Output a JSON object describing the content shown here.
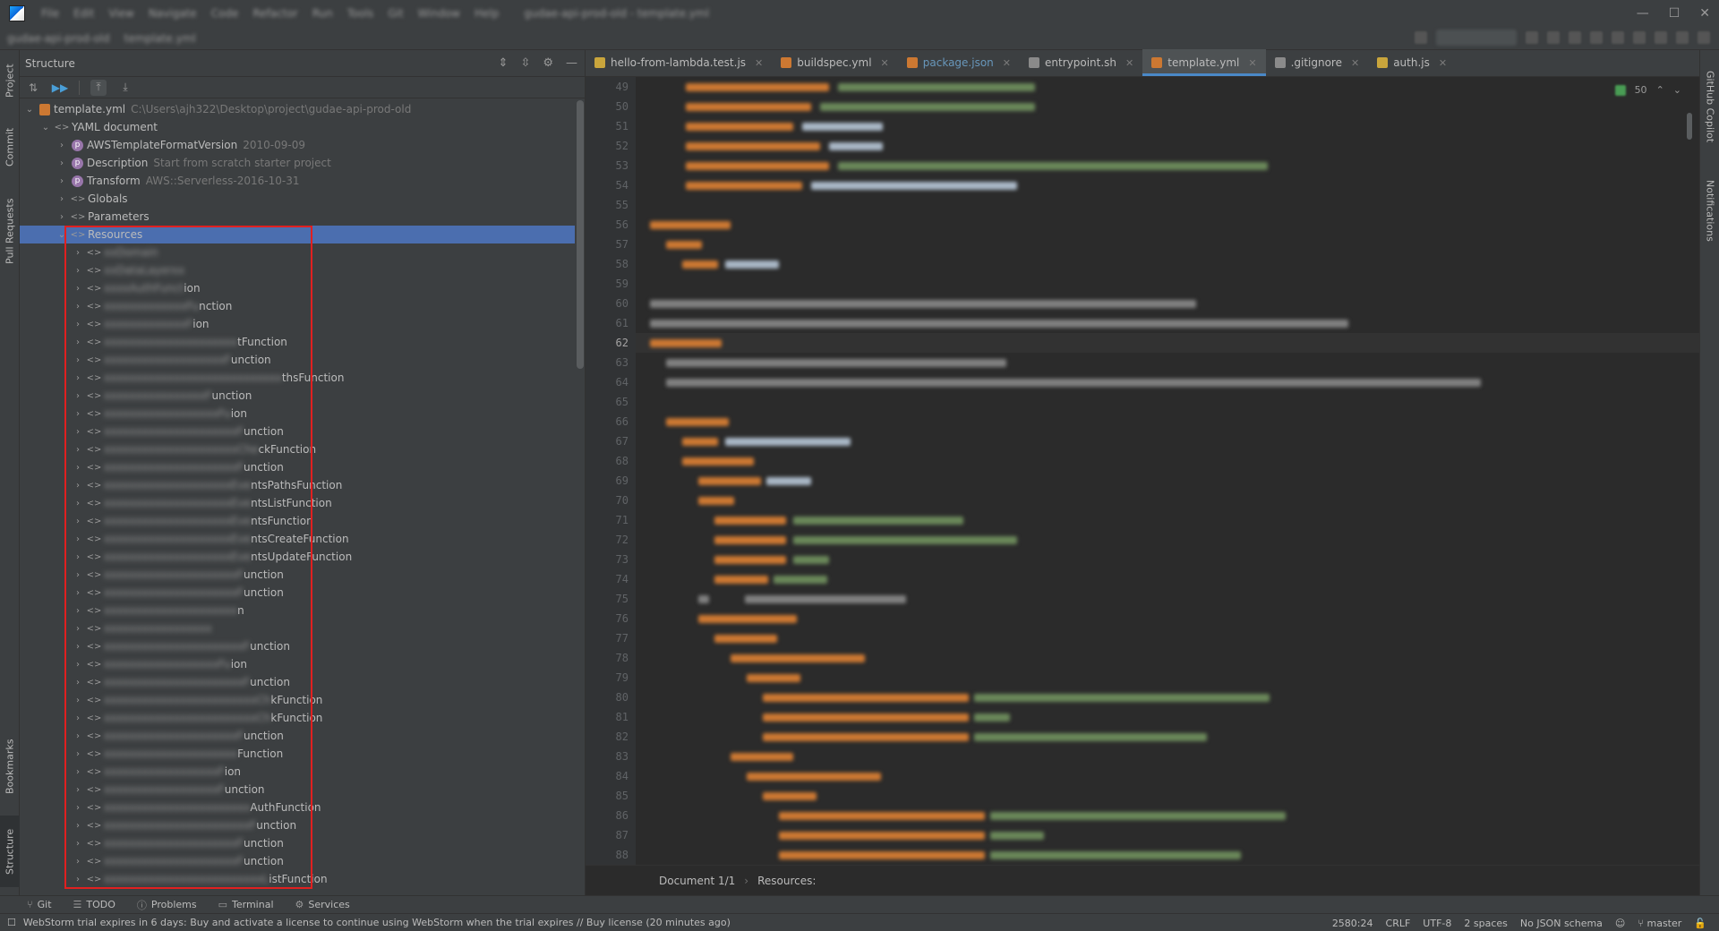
{
  "menubar": {
    "items": [
      "File",
      "Edit",
      "View",
      "Navigate",
      "Code",
      "Refactor",
      "Run",
      "Tools",
      "Git",
      "Window",
      "Help"
    ],
    "window_title": "gudae-api-prod-old - template.yml"
  },
  "toolbar": {
    "breadcrumbs": [
      "gudae-api-prod-old",
      "template.yml"
    ]
  },
  "left_strip": {
    "tabs": [
      "Project",
      "Commit",
      "Pull Requests",
      "Bookmarks",
      "Structure"
    ]
  },
  "right_strip": {
    "tabs": [
      "GitHub Copilot",
      "Notifications"
    ]
  },
  "structure": {
    "title": "Structure",
    "root": {
      "name": "template.yml",
      "path": "C:\\Users\\ajh322\\Desktop\\project\\gudae-api-prod-old"
    },
    "yaml_document": "YAML document",
    "props": [
      {
        "name": "AWSTemplateFormatVersion",
        "value": "2010-09-09"
      },
      {
        "name": "Description",
        "value": "Start from scratch starter project"
      },
      {
        "name": "Transform",
        "value": "AWS::Serverless-2016-10-31"
      }
    ],
    "nodes": [
      "Globals",
      "Parameters",
      "Resources"
    ],
    "resources": [
      {
        "blur": "xxDomain",
        "tail": ""
      },
      {
        "blur": "xxDataLayerxx",
        "tail": ""
      },
      {
        "blur": "xxxxAuthFunct",
        "tail": "ion"
      },
      {
        "blur": "xxxxxxxxxxxxxFu",
        "tail": "nction"
      },
      {
        "blur": "xxxxxxxxxxxxxF",
        "tail": "ion"
      },
      {
        "blur": "xxxxxxxxxxxxxxxxxxxxx",
        "tail": "tFunction"
      },
      {
        "blur": "xxxxxxxxxxxxxxxxxxxF",
        "tail": "unction"
      },
      {
        "blur": "xxxxxxxxxxxxxxxxxxxxxxxxxxxx",
        "tail": "thsFunction"
      },
      {
        "blur": "xxxxxxxxxxxxxxxxF",
        "tail": "unction"
      },
      {
        "blur": "xxxxxxxxxxxxxxxxxxFu",
        "tail": "ion"
      },
      {
        "blur": "xxxxxxxxxxxxxxxxxxxxxF",
        "tail": "unction"
      },
      {
        "blur": "xxxxxxxxxxxxxxxxxxxxxChe",
        "tail": "ckFunction"
      },
      {
        "blur": "xxxxxxxxxxxxxxxxxxxxxF",
        "tail": "unction"
      },
      {
        "blur": "xxxxxxxxxxxxxxxxxxxxEve",
        "tail": "ntsPathsFunction"
      },
      {
        "blur": "xxxxxxxxxxxxxxxxxxxxEve",
        "tail": "ntsListFunction"
      },
      {
        "blur": "xxxxxxxxxxxxxxxxxxxxEve",
        "tail": "ntsFunction"
      },
      {
        "blur": "xxxxxxxxxxxxxxxxxxxxEve",
        "tail": "ntsCreateFunction"
      },
      {
        "blur": "xxxxxxxxxxxxxxxxxxxxEve",
        "tail": "ntsUpdateFunction"
      },
      {
        "blur": "xxxxxxxxxxxxxxxxxxxxxF",
        "tail": "unction"
      },
      {
        "blur": "xxxxxxxxxxxxxxxxxxxxxF",
        "tail": "unction"
      },
      {
        "blur": "xxxxxxxxxxxxxxxxxxxxx",
        "tail": "n"
      },
      {
        "blur": "xxxxxxxxxxxxxxxxx",
        "tail": ""
      },
      {
        "blur": "xxxxxxxxxxxxxxxxxxxxxxF",
        "tail": "unction"
      },
      {
        "blur": "xxxxxxxxxxxxxxxxxxFu",
        "tail": "ion"
      },
      {
        "blur": "xxxxxxxxxxxxxxxxxxxxxxF",
        "tail": "unction"
      },
      {
        "blur": "xxxxxxxxxxxxxxxxxxxxxxxxCh",
        "tail": "kFunction"
      },
      {
        "blur": "xxxxxxxxxxxxxxxxxxxxxxxxCh",
        "tail": "kFunction"
      },
      {
        "blur": "xxxxxxxxxxxxxxxxxxxxxF",
        "tail": "unction"
      },
      {
        "blur": "xxxxxxxxxxxxxxxxxxxxx",
        "tail": "Function"
      },
      {
        "blur": "xxxxxxxxxxxxxxxxxxF",
        "tail": "ion"
      },
      {
        "blur": "xxxxxxxxxxxxxxxxxxF",
        "tail": "unction"
      },
      {
        "blur": "xxxxxxxxxxxxxxxxxxxxxxx",
        "tail": "AuthFunction"
      },
      {
        "blur": "xxxxxxxxxxxxxxxxxxxxxxxF",
        "tail": "unction"
      },
      {
        "blur": "xxxxxxxxxxxxxxxxxxxxxF",
        "tail": "unction"
      },
      {
        "blur": "xxxxxxxxxxxxxxxxxxxxxF",
        "tail": "unction"
      },
      {
        "blur": "xxxxxxxxxxxxxxxxxxxxxxxxxL",
        "tail": "istFunction"
      }
    ]
  },
  "editor": {
    "tabs": [
      {
        "label": "hello-from-lambda.test.js",
        "color": "#c9a53c",
        "active": false,
        "modified": false
      },
      {
        "label": "buildspec.yml",
        "color": "#cc7832",
        "active": false,
        "modified": false
      },
      {
        "label": "package.json",
        "color": "#cc7832",
        "active": false,
        "modified": true
      },
      {
        "label": "entrypoint.sh",
        "color": "#8a8a8a",
        "active": false,
        "modified": false
      },
      {
        "label": "template.yml",
        "color": "#cc7832",
        "active": true,
        "modified": false
      },
      {
        "label": ".gitignore",
        "color": "#8a8a8a",
        "active": false,
        "modified": false
      },
      {
        "label": "auth.js",
        "color": "#c9a53c",
        "active": false,
        "modified": false
      }
    ],
    "inspection_count": "50",
    "line_numbers": [
      49,
      50,
      51,
      52,
      53,
      54,
      55,
      56,
      57,
      58,
      59,
      60,
      61,
      62,
      63,
      64,
      65,
      66,
      67,
      68,
      69,
      70,
      71,
      72,
      73,
      74,
      75,
      76,
      77,
      78,
      79,
      80,
      81,
      82,
      83,
      84,
      85,
      86,
      87,
      88
    ],
    "current_line": 62,
    "breadcrumbs": [
      "Document 1/1",
      "Resources:"
    ]
  },
  "bottom_tools": [
    "Git",
    "TODO",
    "Problems",
    "Terminal",
    "Services"
  ],
  "status": {
    "message": "WebStorm trial expires in 6 days: Buy and activate a license to continue using WebStorm when the trial expires // Buy license (20 minutes ago)",
    "position": "2580:24",
    "line_sep": "CRLF",
    "encoding": "UTF-8",
    "indent": "2 spaces",
    "schema": "No JSON schema",
    "branch": "master"
  },
  "colors": {
    "selection": "#4b6eaf",
    "highlight_box": "#e02020",
    "keyword": "#cc7832",
    "string": "#6a8759",
    "comment": "#808080"
  }
}
